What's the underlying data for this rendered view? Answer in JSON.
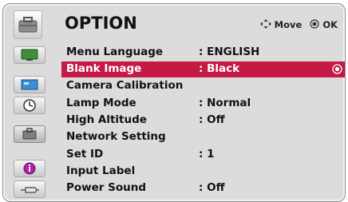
{
  "header": {
    "title": "OPTION",
    "hint_move": "Move",
    "hint_ok": "OK"
  },
  "sidebar": {
    "icons": [
      "picture-icon",
      "screen-icon",
      "clock-icon",
      "option-icon",
      "info-icon",
      "input-icon"
    ],
    "selected": "option-icon"
  },
  "menu": {
    "items": [
      {
        "label": "Menu Language",
        "value": ": ENGLISH"
      },
      {
        "label": "Blank Image",
        "value": ": Black",
        "selected": true
      },
      {
        "label": "Camera Calibration",
        "value": ""
      },
      {
        "label": "Lamp Mode",
        "value": ": Normal"
      },
      {
        "label": "High Altitude",
        "value": ": Off"
      },
      {
        "label": "Network Setting",
        "value": ""
      },
      {
        "label": "Set ID",
        "value": ": 1"
      },
      {
        "label": "Input Label",
        "value": ""
      },
      {
        "label": "Power Sound",
        "value": ": Off"
      }
    ]
  },
  "colors": {
    "selection": "#c41a45",
    "panel": "#dcdcdc"
  }
}
